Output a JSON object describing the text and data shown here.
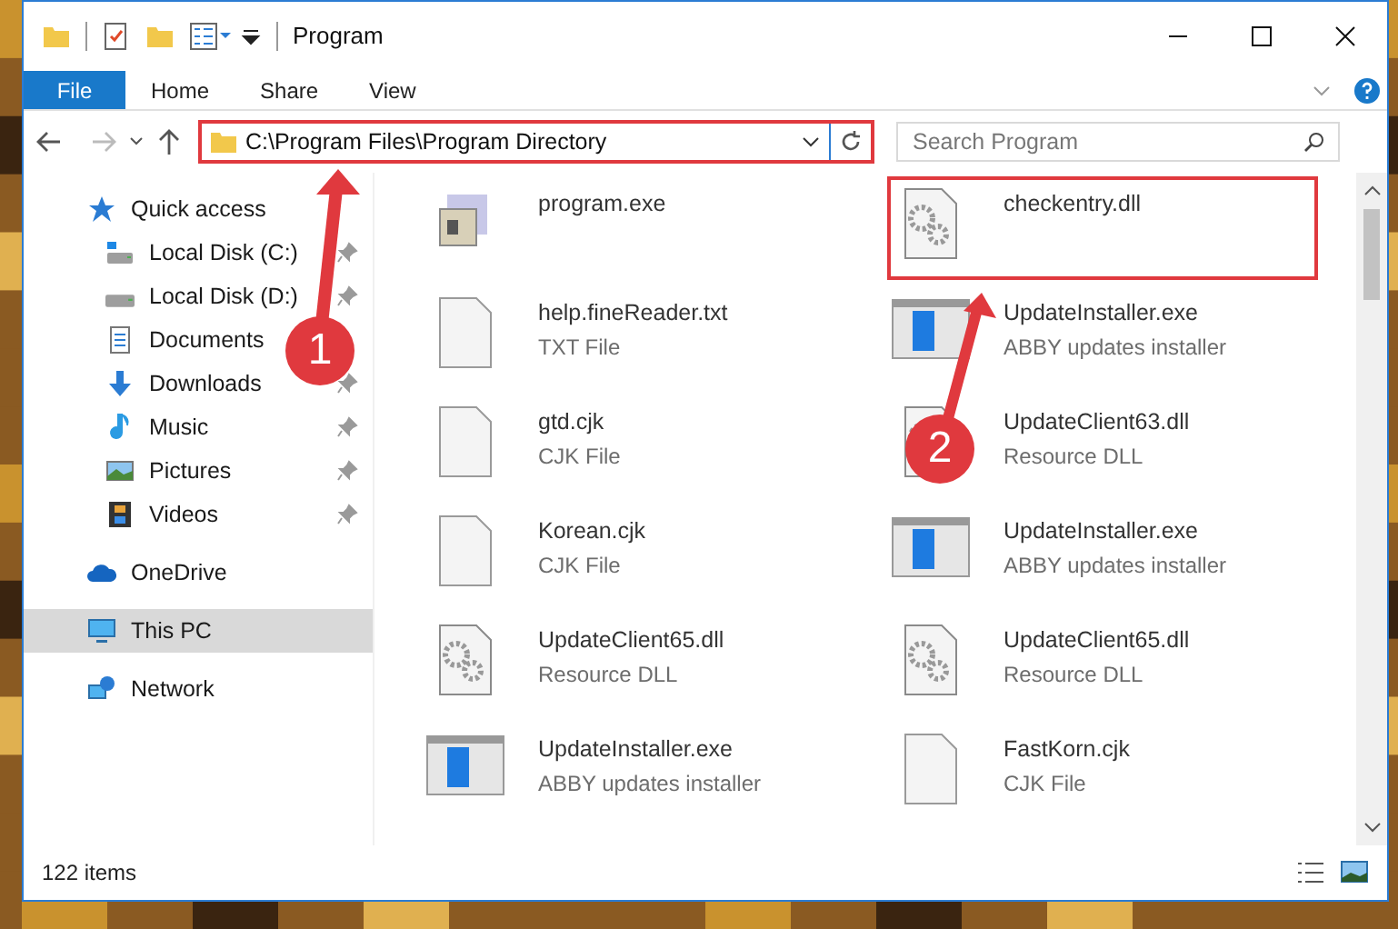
{
  "window": {
    "title": "Program"
  },
  "ribbon_tabs": [
    {
      "label": "File",
      "kind": "file"
    },
    {
      "label": "Home",
      "kind": "tab"
    },
    {
      "label": "Share",
      "kind": "tab"
    },
    {
      "label": "View",
      "kind": "tab"
    }
  ],
  "address_bar": {
    "path": "C:\\Program Files\\Program Directory",
    "highlighted": true
  },
  "search": {
    "placeholder": "Search Program"
  },
  "sidebar": {
    "items": [
      {
        "label": "Quick access",
        "kind": "star",
        "selected": false,
        "children": [
          {
            "label": "Local Disk (C:)",
            "kind": "drive-c",
            "pinned": true,
            "selected": false
          },
          {
            "label": "Local Disk (D:)",
            "kind": "drive",
            "pinned": true,
            "selected": false
          },
          {
            "label": "Documents",
            "kind": "documents",
            "selected": false
          },
          {
            "label": "Downloads",
            "kind": "downloads",
            "pinned": true,
            "selected": false
          },
          {
            "label": "Music",
            "kind": "music",
            "pinned": true,
            "selected": false
          },
          {
            "label": "Pictures",
            "kind": "pictures",
            "pinned": true,
            "selected": false
          },
          {
            "label": "Videos",
            "kind": "videos",
            "pinned": true,
            "selected": false
          }
        ]
      },
      {
        "label": "OneDrive",
        "kind": "cloud",
        "selected": false
      },
      {
        "label": "This PC",
        "kind": "pc",
        "selected": true
      },
      {
        "label": "Network",
        "kind": "network",
        "selected": false
      }
    ]
  },
  "files": [
    {
      "name": "program.exe",
      "kind": "exe",
      "highlighted": false
    },
    {
      "name": "checkentry.dll",
      "kind": "dll",
      "highlighted": true
    },
    {
      "name": "help.fineReader.txt",
      "type": "TXT File",
      "kind": "text",
      "highlighted": false
    },
    {
      "name": "UpdateInstaller.exe",
      "type": "ABBY updates installer",
      "kind": "installer",
      "highlighted": false
    },
    {
      "name": "gtd.cjk",
      "type": "CJK File",
      "kind": "text",
      "highlighted": false
    },
    {
      "name": "UpdateClient63.dll",
      "type": "Resource DLL",
      "kind": "dll",
      "highlighted": false
    },
    {
      "name": "Korean.cjk",
      "type": "CJK File",
      "kind": "text",
      "highlighted": false
    },
    {
      "name": "UpdateInstaller.exe",
      "type": "ABBY updates installer",
      "kind": "installer",
      "highlighted": false
    },
    {
      "name": "UpdateClient65.dll",
      "type": "Resource DLL",
      "kind": "dll",
      "highlighted": false
    },
    {
      "name": "UpdateClient65.dll",
      "type": "Resource DLL",
      "kind": "dll",
      "highlighted": false
    },
    {
      "name": "UpdateInstaller.exe",
      "type": "ABBY updates installer",
      "kind": "installer",
      "highlighted": false
    },
    {
      "name": "FastKorn.cjk",
      "type": "CJK File",
      "kind": "text",
      "highlighted": false
    }
  ],
  "status_bar": {
    "count": "122 items"
  },
  "callouts": [
    {
      "label": "1"
    },
    {
      "label": "2"
    }
  ]
}
